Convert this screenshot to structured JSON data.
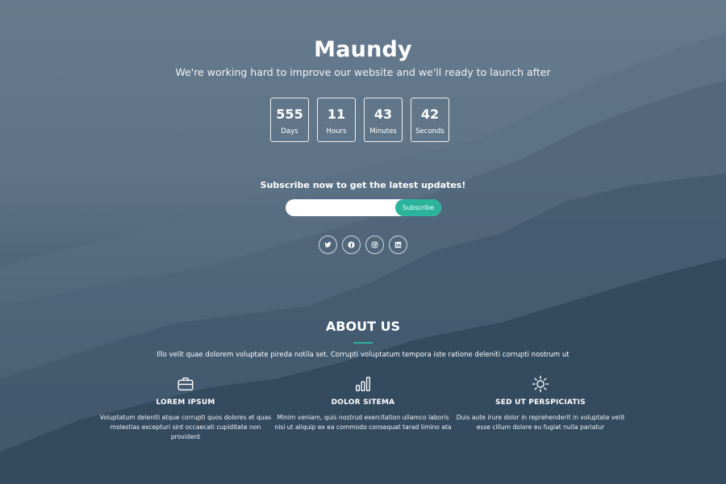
{
  "hero": {
    "brand": "Maundy",
    "tagline": "We're working hard to improve our website and we'll ready to launch after"
  },
  "countdown": [
    {
      "value": "555",
      "label": "Days"
    },
    {
      "value": "11",
      "label": "Hours"
    },
    {
      "value": "43",
      "label": "Minutes"
    },
    {
      "value": "42",
      "label": "Seconds"
    }
  ],
  "subscribe": {
    "title": "Subscribe now to get the latest updates!",
    "input_value": "",
    "button_label": "Subscribe"
  },
  "social": [
    {
      "icon": "twitter-icon"
    },
    {
      "icon": "facebook-icon"
    },
    {
      "icon": "instagram-icon"
    },
    {
      "icon": "linkedin-icon"
    }
  ],
  "about": {
    "title": "ABOUT US",
    "description": "Illo velit quae dolorem voluptate pireda notila set. Corrupti voluptatum tempora iste ratione deleniti corrupti nostrum ut",
    "features": [
      {
        "icon": "briefcase-icon",
        "title": "LOREM IPSUM",
        "text": "Voluptatum deleniti atque corrupti quos dolores et quas molestias excepturi sint occaecati cupiditate non provident"
      },
      {
        "icon": "bar-chart-icon",
        "title": "DOLOR SITEMA",
        "text": "Minim veniam, quis nostrud exercitation ullamco laboris nisi ut aliquip ex ea commodo consequat tarad limino ata"
      },
      {
        "icon": "sun-icon",
        "title": "SED UT PERSPICIATIS",
        "text": "Duis aute irure dolor in reprehenderit in voluptate velit esse cillum dolore eu fugiat nulla pariatur"
      }
    ]
  },
  "colors": {
    "accent": "#2bb39b",
    "background_top": "#667a8d",
    "background_bottom": "#22374a"
  }
}
